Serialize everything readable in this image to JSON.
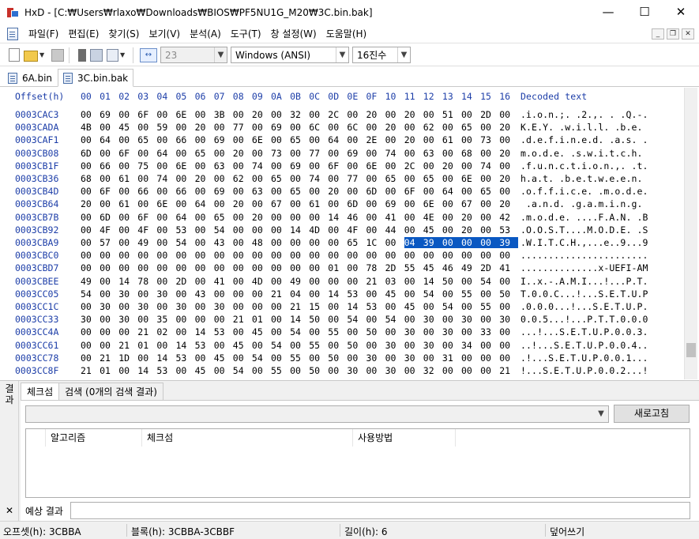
{
  "window": {
    "app_name": "HxD",
    "title": "HxD - [C:₩Users₩rlaxo₩Downloads₩BIOS₩PF5NU1G_M20₩3C.bin.bak]",
    "controls": {
      "minimize": "—",
      "maximize": "☐",
      "close": "✕"
    }
  },
  "menu": {
    "items": [
      "파일(F)",
      "편집(E)",
      "찾기(S)",
      "보기(V)",
      "분석(A)",
      "도구(T)",
      "창 설정(W)",
      "도움말(H)"
    ],
    "mdi": {
      "minimize": "_",
      "restore": "❐",
      "close": "✕"
    }
  },
  "toolbar": {
    "bytes_per_row": "23",
    "charset": "Windows (ANSI)",
    "offset_base": "16진수",
    "width_label": "↔"
  },
  "tabs": [
    {
      "label": "6A.bin"
    },
    {
      "label": "3C.bin.bak"
    }
  ],
  "hex": {
    "header": {
      "offset_label": "Offset(h)",
      "columns": [
        "00",
        "01",
        "02",
        "03",
        "04",
        "05",
        "06",
        "07",
        "08",
        "09",
        "0A",
        "0B",
        "0C",
        "0D",
        "0E",
        "0F",
        "10",
        "11",
        "12",
        "13",
        "14",
        "15",
        "16"
      ],
      "decoded_label": "Decoded text"
    },
    "selection": {
      "row": 11,
      "from_col": 17,
      "to_col": 22
    },
    "rows": [
      {
        "offset": "0003CAC3",
        "bytes": "00 69 00 6F 00 6E 00 3B 00 20 00 32 00 2C 00 20 00 20 00 51 00 2D 00",
        "text": ".i.o.n.;. .2.,. . .Q.-."
      },
      {
        "offset": "0003CADA",
        "bytes": "4B 00 45 00 59 00 20 00 77 00 69 00 6C 00 6C 00 20 00 62 00 65 00 20",
        "text": "K.E.Y. .w.i.l.l. .b.e."
      },
      {
        "offset": "0003CAF1",
        "bytes": "00 64 00 65 00 66 00 69 00 6E 00 65 00 64 00 2E 00 20 00 61 00 73 00 20",
        "text": ".d.e.f.i.n.e.d. .a.s. ."
      },
      {
        "offset": "0003CB08",
        "bytes": "6D 00 6F 00 64 00 65 00 20 00 73 00 77 00 69 00 74 00 63 00 68 00 20",
        "text": "m.o.d.e. .s.w.i.t.c.h."
      },
      {
        "offset": "0003CB1F",
        "bytes": "00 66 00 75 00 6E 00 63 00 74 00 69 00 6F 00 6E 00 2C 00 20 00 74 00",
        "text": ".f.u.n.c.t.i.o.n.,. .t."
      },
      {
        "offset": "0003CB36",
        "bytes": "68 00 61 00 74 00 20 00 62 00 65 00 74 00 77 00 65 00 65 00 6E 00 20",
        "text": "h.a.t. .b.e.t.w.e.e.n."
      },
      {
        "offset": "0003CB4D",
        "bytes": "00 6F 00 66 00 66 00 69 00 63 00 65 00 20 00 6D 00 6F 00 64 00 65 00",
        "text": ".o.f.f.i.c.e. .m.o.d.e."
      },
      {
        "offset": "0003CB64",
        "bytes": "20 00 61 00 6E 00 64 00 20 00 67 00 61 00 6D 00 69 00 6E 00 67 00 20",
        "text": " .a.n.d. .g.a.m.i.n.g."
      },
      {
        "offset": "0003CB7B",
        "bytes": "00 6D 00 6F 00 64 00 65 00 20 00 00 00 14 46 00 41 00 4E 00 20 00 42",
        "text": ".m.o.d.e. ....F.A.N. .B"
      },
      {
        "offset": "0003CB92",
        "bytes": "00 4F 00 4F 00 53 00 54 00 00 00 14 4D 00 4F 00 44 00 45 00 20 00 53",
        "text": ".O.O.S.T....M.O.D.E. .S"
      },
      {
        "offset": "0003CBA9",
        "bytes": "00 57 00 49 00 54 00 43 00 48 00 00 00 00 65 1C 00 04 39 00 00 00 39",
        "text": ".W.I.T.C.H.,...e..9...9"
      },
      {
        "offset": "0003CBC0",
        "bytes": "00 00 00 00 00 00 00 00 00 00 00 00 00 00 00 00 00 00 00 00 00 00 00",
        "text": "......................."
      },
      {
        "offset": "0003CBD7",
        "bytes": "00 00 00 00 00 00 00 00 00 00 00 00 00 01 00 78 2D 55 45 46 49 2D 41 4D",
        "text": "..............x-UEFI-AM"
      },
      {
        "offset": "0003CBEE",
        "bytes": "49 00 14 78 00 2D 00 41 00 4D 00 49 00 00 00 21 03 00 14 50 00 54 00",
        "text": "I..x.-.A.M.I...!...P.T."
      },
      {
        "offset": "0003CC05",
        "bytes": "54 00 30 00 30 00 43 00 00 00 21 04 00 14 53 00 45 00 54 00 55 00 50",
        "text": "T.0.0.C...!...S.E.T.U.P"
      },
      {
        "offset": "0003CC1C",
        "bytes": "00 30 00 30 00 30 00 30 00 00 00 21 15 00 14 53 00 45 00 54 00 55 00 50",
        "text": ".0.0.0...!...S.E.T.U.P."
      },
      {
        "offset": "0003CC33",
        "bytes": "30 00 30 00 35 00 00 00 21 01 00 14 50 00 54 00 54 00 30 00 30 00 30",
        "text": "0.0.5...!...P.T.T.0.0.0"
      },
      {
        "offset": "0003CC4A",
        "bytes": "00 00 00 21 02 00 14 53 00 45 00 54 00 55 00 50 00 30 00 30 00 33 00",
        "text": "...!...S.E.T.U.P.0.0.3."
      },
      {
        "offset": "0003CC61",
        "bytes": "00 00 21 01 00 14 53 00 45 00 54 00 55 00 50 00 30 00 30 00 34 00 00",
        "text": "..!...S.E.T.U.P.0.0.4.."
      },
      {
        "offset": "0003CC78",
        "bytes": "00 21 1D 00 14 53 00 45 00 54 00 55 00 50 00 30 00 30 00 31 00 00 00",
        "text": ".!...S.E.T.U.P.0.0.1..."
      },
      {
        "offset": "0003CC8F",
        "bytes": "21 01 00 14 53 00 45 00 54 00 55 00 50 00 30 00 30 00 32 00 00 00 21",
        "text": "!...S.E.T.U.P.0.0.2...!"
      }
    ]
  },
  "results": {
    "side_label": "결과",
    "close_label": "✕",
    "tabs": [
      {
        "label": "체크섬"
      },
      {
        "label": "검색 (0개의 검색 결과)"
      }
    ],
    "refresh_button": "새로고침",
    "columns": [
      "알고리즘",
      "체크섬",
      "사용방법"
    ],
    "expected_label": "예상 결과"
  },
  "status": {
    "offset": "오프셋(h): 3CBBA",
    "block": "블록(h): 3CBBA-3CBBF",
    "length": "길이(h): 6",
    "mode": "덮어쓰기"
  }
}
